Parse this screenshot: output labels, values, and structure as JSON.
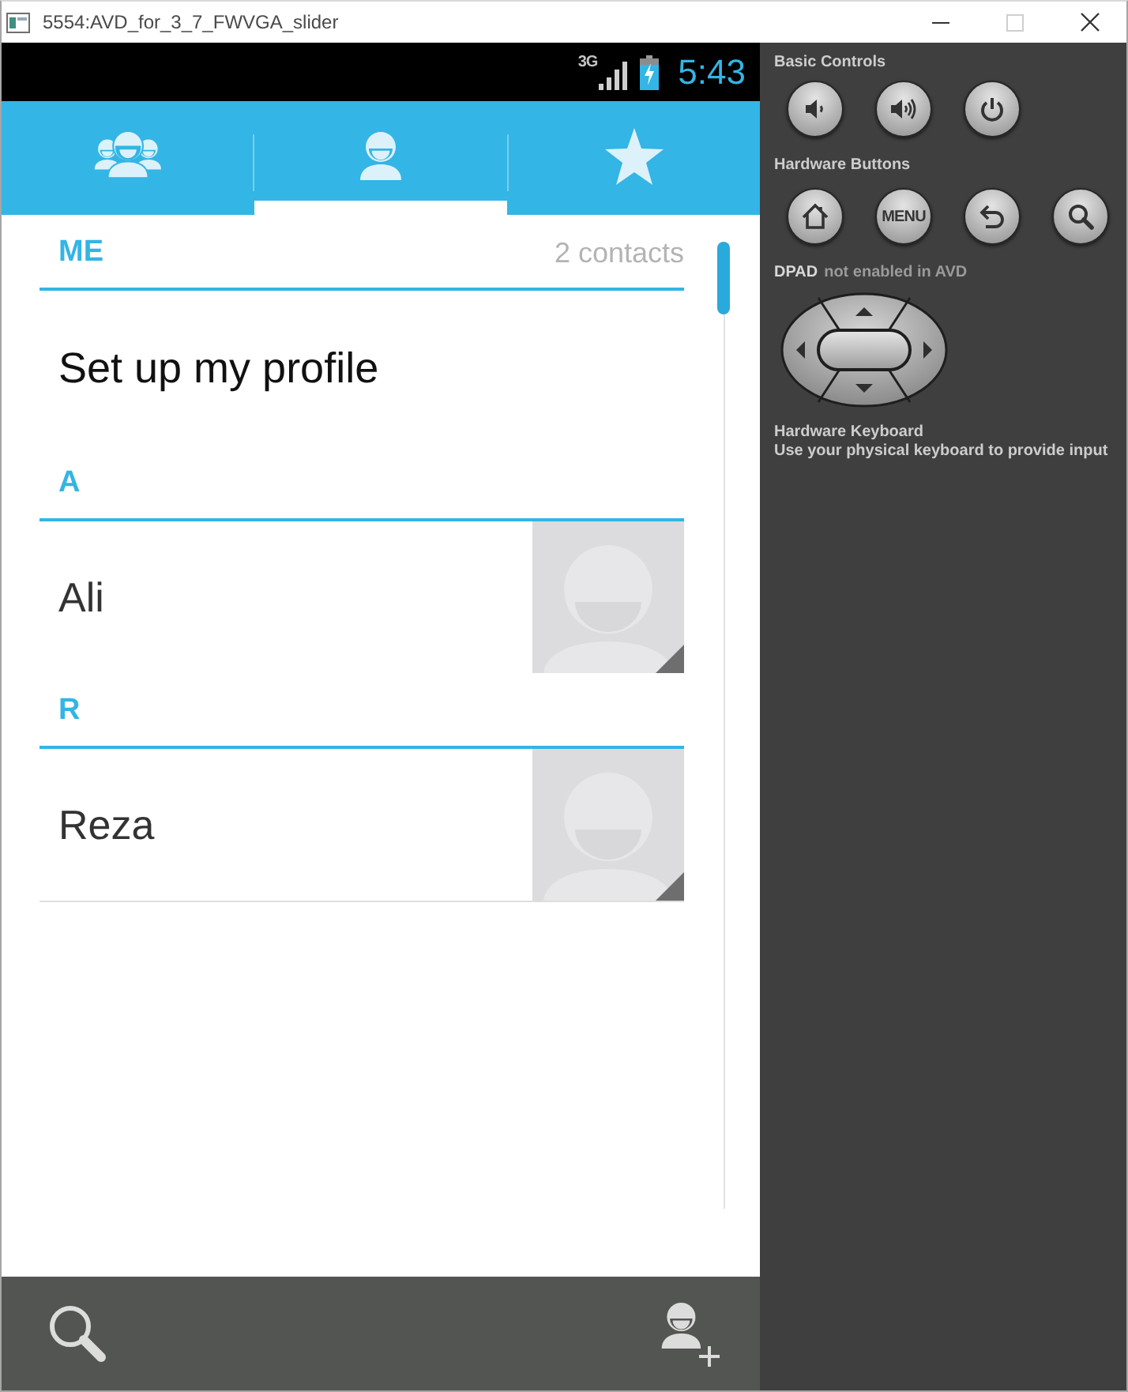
{
  "window": {
    "title": "5554:AVD_for_3_7_FWVGA_slider",
    "controls": [
      {
        "kind": "minimize",
        "disabled": false
      },
      {
        "kind": "maximize",
        "disabled": true
      },
      {
        "kind": "close",
        "disabled": false
      }
    ]
  },
  "status_bar": {
    "network": "3G",
    "time": "5:43"
  },
  "tabs": [
    {
      "kind": "groups",
      "selected": false
    },
    {
      "kind": "contacts",
      "selected": true
    },
    {
      "kind": "favorites",
      "selected": false
    }
  ],
  "contact_list": {
    "me": {
      "header": "ME",
      "count": "2 contacts",
      "prompt": "Set up my profile"
    },
    "sections": [
      {
        "letter": "A",
        "contacts": [
          {
            "name": "Ali"
          }
        ]
      },
      {
        "letter": "R",
        "contacts": [
          {
            "name": "Reza"
          }
        ]
      }
    ]
  },
  "bottom_bar": {
    "actions": [
      {
        "kind": "search"
      },
      {
        "kind": "add_contact"
      }
    ]
  },
  "emulator_panel": {
    "basic_controls": {
      "title": "Basic Controls",
      "buttons": [
        {
          "kind": "volume_down"
        },
        {
          "kind": "volume_up"
        },
        {
          "kind": "power"
        }
      ]
    },
    "hardware_buttons": {
      "title": "Hardware Buttons",
      "buttons": [
        {
          "kind": "home"
        },
        {
          "kind": "menu",
          "label": "MENU"
        },
        {
          "kind": "back"
        },
        {
          "kind": "search"
        }
      ]
    },
    "dpad": {
      "title": "DPAD",
      "note": "not enabled in AVD"
    },
    "keyboard": {
      "title": "Hardware Keyboard",
      "note": "Use your physical keyboard to provide input"
    }
  }
}
